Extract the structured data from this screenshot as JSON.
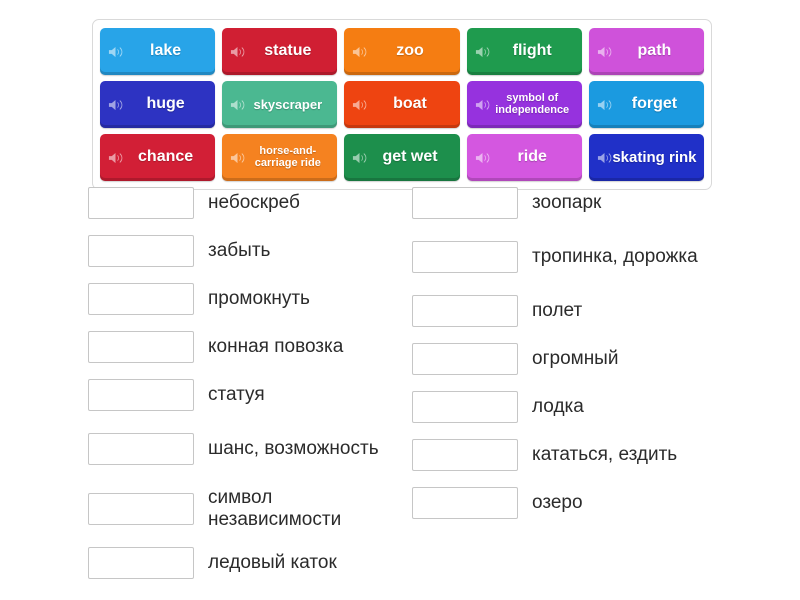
{
  "tray": {
    "rows": [
      [
        {
          "label": "lake",
          "color": "#28a4e8",
          "size": "normal",
          "icon": "speaker-icon"
        },
        {
          "label": "statue",
          "color": "#d01f33",
          "size": "normal",
          "icon": "speaker-icon"
        },
        {
          "label": "zoo",
          "color": "#f57d12",
          "size": "normal",
          "icon": "speaker-icon"
        },
        {
          "label": "flight",
          "color": "#1f9b4e",
          "size": "normal",
          "icon": "speaker-icon"
        },
        {
          "label": "path",
          "color": "#cf52da",
          "size": "normal",
          "icon": "speaker-icon"
        }
      ],
      [
        {
          "label": "huge",
          "color": "#2d33c2",
          "size": "normal",
          "icon": "speaker-icon"
        },
        {
          "label": "skyscraper",
          "color": "#4bb891",
          "size": "medium",
          "icon": "speaker-icon"
        },
        {
          "label": "boat",
          "color": "#ee4411",
          "size": "normal",
          "icon": "speaker-icon"
        },
        {
          "label": "symbol of independence",
          "color": "#9632de",
          "size": "small",
          "icon": "speaker-icon"
        },
        {
          "label": "forget",
          "color": "#1b9ae0",
          "size": "normal",
          "icon": "speaker-icon"
        }
      ],
      [
        {
          "label": "chance",
          "color": "#d21f36",
          "size": "normal",
          "icon": "speaker-icon"
        },
        {
          "label": "horse-and-carriage ride",
          "color": "#f58220",
          "size": "small",
          "icon": "speaker-icon"
        },
        {
          "label": "get wet",
          "color": "#1d8f4c",
          "size": "normal",
          "icon": "speaker-icon"
        },
        {
          "label": "ride",
          "color": "#d457e0",
          "size": "normal",
          "icon": "speaker-icon"
        },
        {
          "label": "skating rink",
          "color": "#2030c8",
          "size": "two-line",
          "icon": "speaker-icon"
        }
      ]
    ]
  },
  "answers": {
    "left": [
      {
        "text": "небоскреб",
        "placeholder": ""
      },
      {
        "text": "забыть",
        "placeholder": ""
      },
      {
        "text": "промокнуть",
        "placeholder": ""
      },
      {
        "text": "конная повозка",
        "placeholder": ""
      },
      {
        "text": "статуя",
        "placeholder": ""
      },
      {
        "text": "шанс, возможность",
        "placeholder": ""
      },
      {
        "text": "символ независимости",
        "placeholder": ""
      },
      {
        "text": "ледовый каток",
        "placeholder": ""
      }
    ],
    "right": [
      {
        "text": "зоопарк",
        "placeholder": ""
      },
      {
        "text": "тропинка, дорожка",
        "placeholder": ""
      },
      {
        "text": "полет",
        "placeholder": ""
      },
      {
        "text": "огромный",
        "placeholder": ""
      },
      {
        "text": "лодка",
        "placeholder": ""
      },
      {
        "text": "кататься, ездить",
        "placeholder": ""
      },
      {
        "text": "озеро",
        "placeholder": ""
      }
    ]
  },
  "colors": {
    "tray_border": "#d9d9d9",
    "box_border": "#c6c6c6",
    "text": "#2b2b2b",
    "tile_text": "#ffffff"
  }
}
